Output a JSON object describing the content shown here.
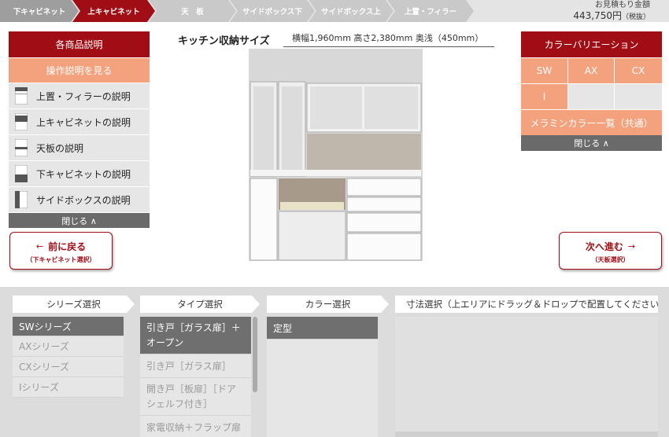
{
  "steps": [
    {
      "label": "下キャビネット",
      "state": "done"
    },
    {
      "label": "上キャビネット",
      "state": "current"
    },
    {
      "label": "天　板",
      "state": "todo"
    },
    {
      "label": "サイドボックス下",
      "state": "todo"
    },
    {
      "label": "サイドボックス上",
      "state": "todo"
    },
    {
      "label": "上置・フィラー",
      "state": "todo"
    }
  ],
  "estimate": {
    "label": "お見積もり金額",
    "price": "443,750円",
    "tax": "（税抜）"
  },
  "left_panel": {
    "header": "各商品説明",
    "guide": "操作説明を見る",
    "items": [
      {
        "label": "上置・フィラーの説明",
        "icon": "top-filler-icon"
      },
      {
        "label": "上キャビネットの説明",
        "icon": "upper-cabinet-icon"
      },
      {
        "label": "天板の説明",
        "icon": "countertop-icon"
      },
      {
        "label": "下キャビネットの説明",
        "icon": "lower-cabinet-icon"
      },
      {
        "label": "サイドボックスの説明",
        "icon": "side-box-icon"
      }
    ],
    "close": "閉じる ∧"
  },
  "prev_button": {
    "label": "前に戻る",
    "sub": "（下キャビネット選択）",
    "arrow": "←"
  },
  "next_button": {
    "label": "次へ進む",
    "sub": "（天板選択）",
    "arrow": "→"
  },
  "size": {
    "title": "キッチン収納サイズ",
    "value": "横幅1,960mm  高さ2,380mm  奥浅（450mm）"
  },
  "color_panel": {
    "header": "カラーバリエーション",
    "options": [
      {
        "label": "SW",
        "enabled": true
      },
      {
        "label": "AX",
        "enabled": true
      },
      {
        "label": "CX",
        "enabled": true
      },
      {
        "label": "I",
        "enabled": true
      },
      {
        "label": "",
        "enabled": false
      },
      {
        "label": "",
        "enabled": false
      }
    ],
    "melamine": "メラミンカラー一覧（共通）",
    "close": "閉じる ∧"
  },
  "columns": {
    "series": {
      "header": "シリーズ選択",
      "items": [
        {
          "label": "SWシリーズ",
          "selected": true
        },
        {
          "label": "AXシリーズ",
          "selected": false
        },
        {
          "label": "CXシリーズ",
          "selected": false
        },
        {
          "label": "Iシリーズ",
          "selected": false
        }
      ]
    },
    "type": {
      "header": "タイプ選択",
      "items": [
        {
          "label": "引き戸［ガラス扉］＋オープン",
          "selected": true
        },
        {
          "label": "引き戸［ガラス扉］",
          "selected": false
        },
        {
          "label": "開き戸［板扉］［ドアシェルフ付き］",
          "selected": false
        },
        {
          "label": "家電収納＋フラップ扉",
          "selected": false
        }
      ]
    },
    "color": {
      "header": "カラー選択",
      "items": [
        {
          "label": "定型",
          "selected": true
        }
      ]
    },
    "size_select": {
      "header": "寸法選択（上エリアにドラッグ＆ドロップで配置してください）"
    }
  },
  "colors": {
    "brand": "#a00d14",
    "accent": "#f4a27d",
    "done_step": "#9e9e9e",
    "todo_step": "#c9c9c9"
  }
}
